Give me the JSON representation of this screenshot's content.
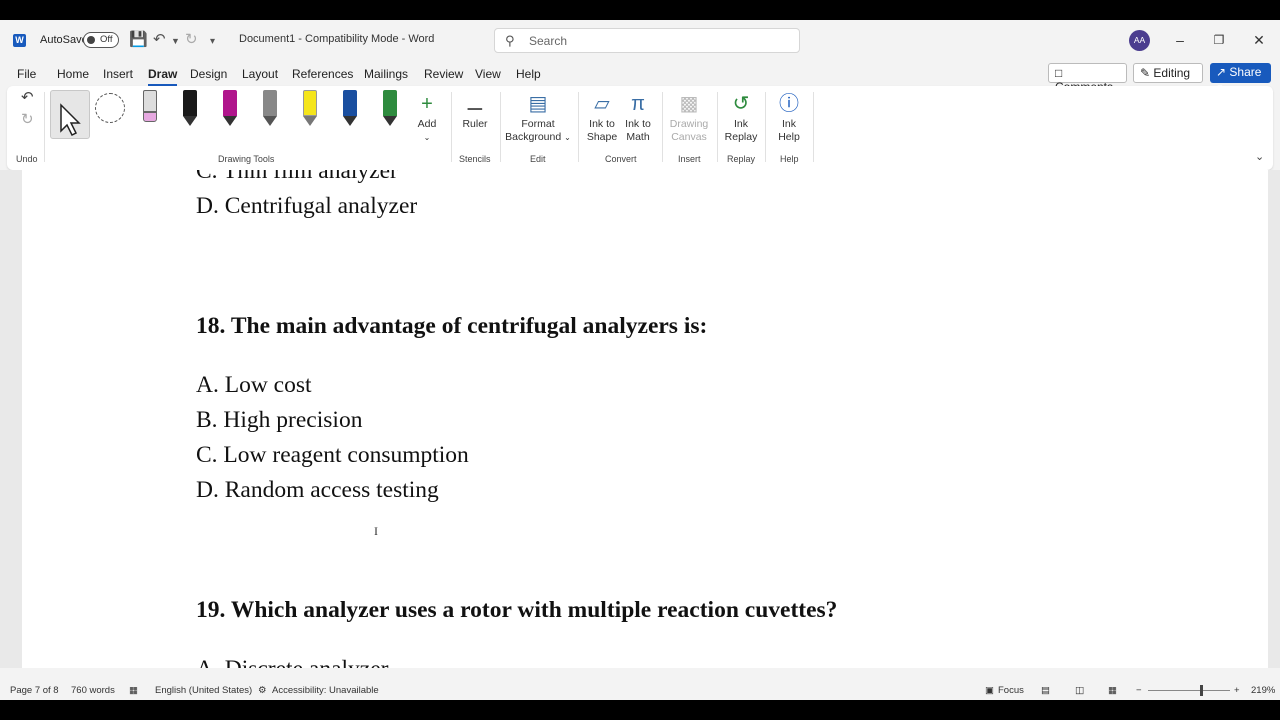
{
  "titlebar": {
    "autosave_label": "AutoSave",
    "autosave_state": "Off",
    "document_title": "Document1  -  Compatibility Mode  -  Word",
    "search_placeholder": "Search",
    "avatar_initials": "AA"
  },
  "menu": {
    "tabs": [
      "File",
      "Home",
      "Insert",
      "Draw",
      "Design",
      "Layout",
      "References",
      "Mailings",
      "Review",
      "View",
      "Help"
    ],
    "active_tab": "Draw",
    "comments_label": "Comments",
    "editing_label": "Editing",
    "share_label": "Share"
  },
  "ribbon": {
    "groups": {
      "undo": "Undo",
      "drawing_tools": "Drawing Tools",
      "stencils": "Stencils",
      "edit": "Edit",
      "convert": "Convert",
      "insert": "Insert",
      "replay": "Replay",
      "help": "Help"
    },
    "add_label": "Add",
    "ruler_label": "Ruler",
    "format_background_line1": "Format",
    "format_background_line2": "Background",
    "ink_to_shape_line1": "Ink to",
    "ink_to_shape_line2": "Shape",
    "ink_to_math_line1": "Ink to",
    "ink_to_math_line2": "Math",
    "drawing_canvas_line1": "Drawing",
    "drawing_canvas_line2": "Canvas",
    "ink_replay_line1": "Ink",
    "ink_replay_line2": "Replay",
    "ink_help_line1": "Ink",
    "ink_help_line2": "Help",
    "pen_colors": [
      "#1a1a1a",
      "#b0158c",
      "#777777",
      "#f5e51b",
      "#1a4fa0",
      "#2e8b3e"
    ]
  },
  "document": {
    "lines": [
      "C. Thin film analyzer",
      "D. Centrifugal analyzer",
      "18. The main advantage of centrifugal analyzers is:",
      "A. Low cost",
      "B. High precision",
      "C. Low reagent consumption",
      "D. Random access testing",
      "19. Which analyzer uses a rotor with multiple reaction cuvettes?",
      "A. Discrete analyzer"
    ]
  },
  "statusbar": {
    "page": "Page 7 of 8",
    "words": "760 words",
    "language": "English (United States)",
    "accessibility": "Accessibility: Unavailable",
    "focus": "Focus",
    "zoom": "219%"
  }
}
